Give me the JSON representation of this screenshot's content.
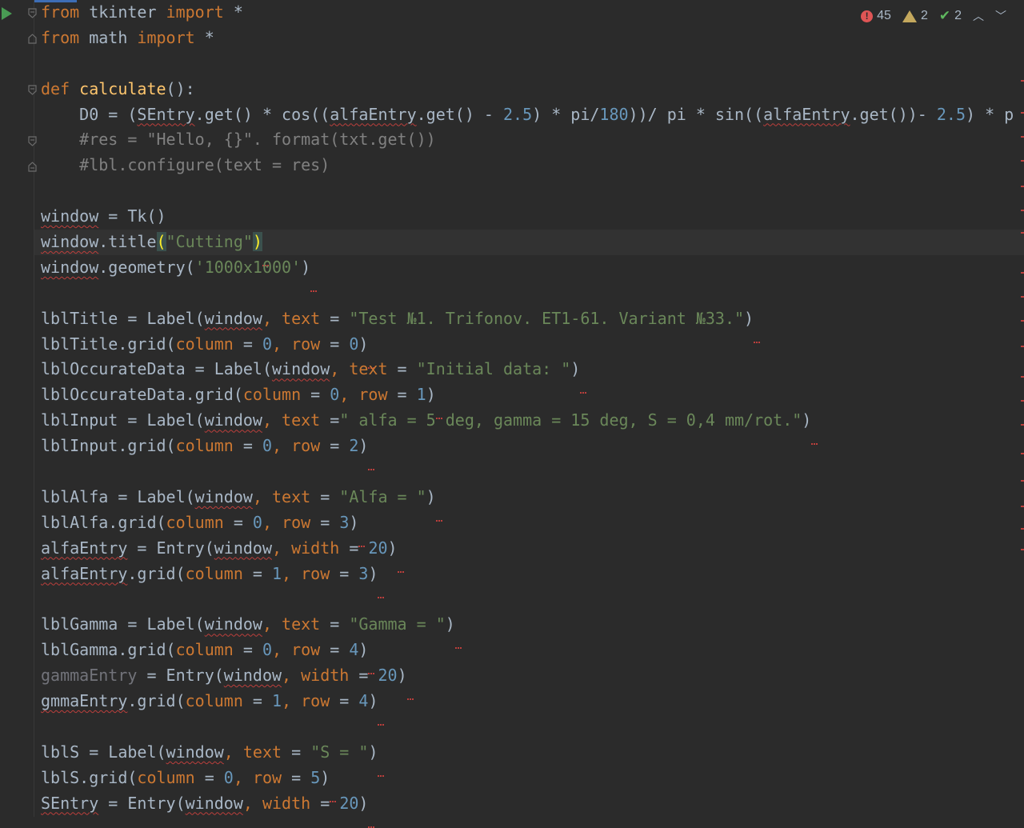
{
  "inspection": {
    "errors": "45",
    "warnings": "2",
    "weak_warnings": "2"
  },
  "code_lines": [
    "from tkinter import *",
    "from math import *",
    "",
    "def calculate():",
    "    D0 = (SEntry.get() * cos((alfaEntry.get() - 2.5) * pi/180))/ pi * sin((alfaEntry.get())- 2.5) * p",
    "    #res = \"Hello, {}\". format(txt.get())",
    "    #lbl.configure(text = res)",
    "",
    "window = Tk()",
    "window.title(\"Cutting\")",
    "window.geometry('1000x1000')",
    "",
    "lblTitle = Label(window, text = \"Test №1. Trifonov. ET1-61. Variant №33.\")",
    "lblTitle.grid(column = 0, row = 0)",
    "lblOccurateData = Label(window, text = \"Initial data: \")",
    "lblOccurateData.grid(column = 0, row = 1)",
    "lblInput = Label(window, text =\" alfa = 5 deg, gamma = 15 deg, S = 0,4 mm/rot.\")",
    "lblInput.grid(column = 0, row = 2)",
    "",
    "lblAlfa = Label(window, text = \"Alfa = \")",
    "lblAlfa.grid(column = 0, row = 3)",
    "alfaEntry = Entry(window, width = 20)",
    "alfaEntry.grid(column = 1, row = 3)",
    "",
    "lblGamma = Label(window, text = \"Gamma = \")",
    "lblGamma.grid(column = 0, row = 4)",
    "gammaEntry = Entry(window, width = 20)",
    "gmmaEntry.grid(column = 1, row = 4)",
    "",
    "lblS = Label(window, text = \"S = \")",
    "lblS.grid(column = 0, row = 5)",
    "SEntry = Entry(window, width = 20)"
  ]
}
